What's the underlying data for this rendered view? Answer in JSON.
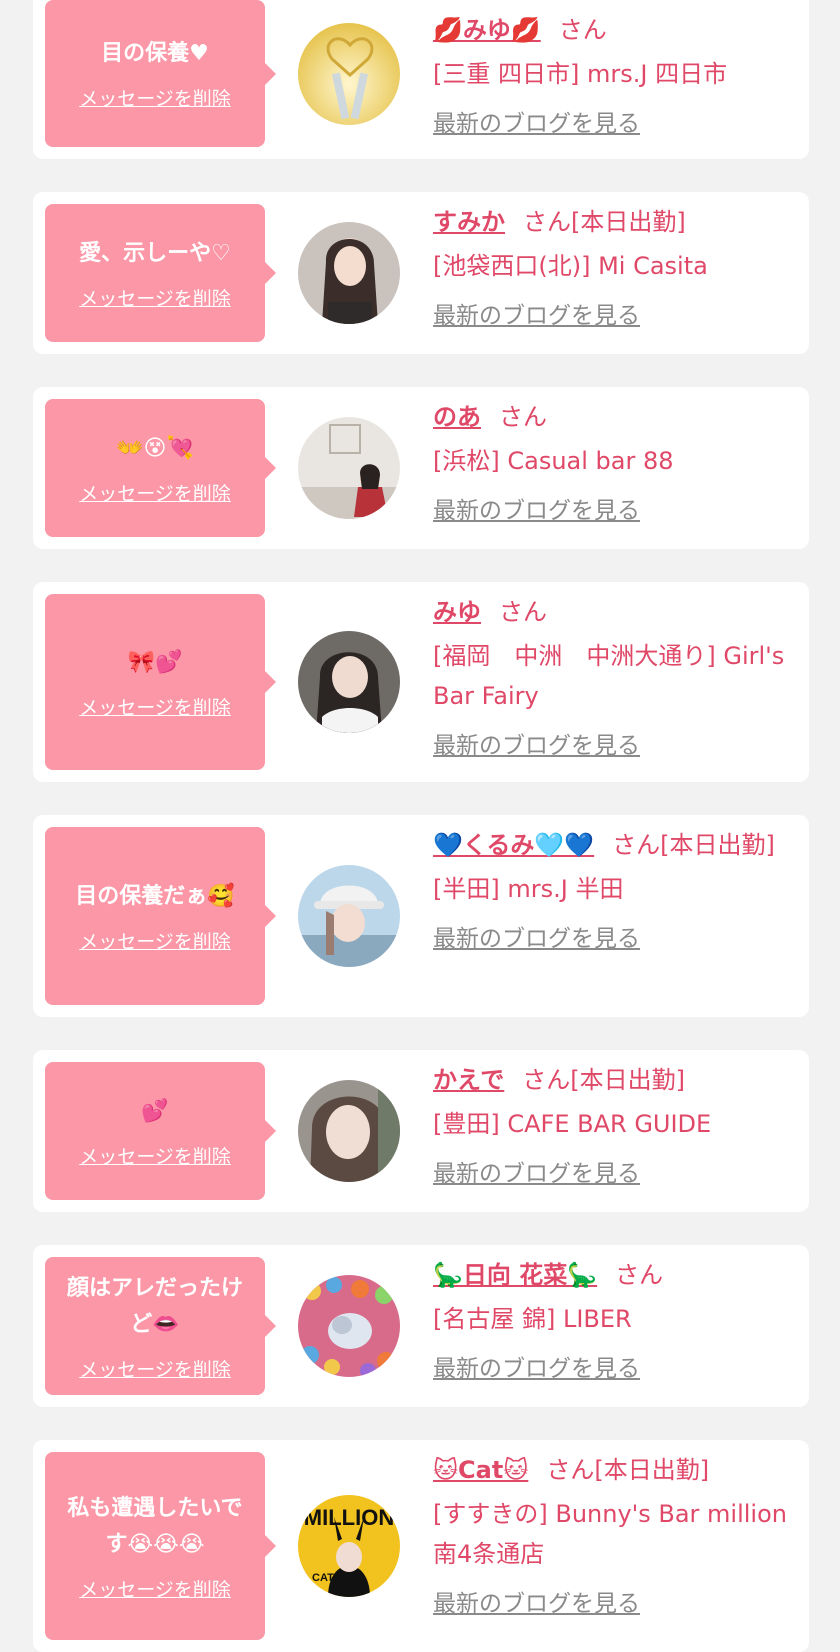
{
  "colors": {
    "accent": "#e04868",
    "bubble": "#fb97a6",
    "link_gray": "#8a8a8a",
    "background": "#f2f2f2"
  },
  "entries": [
    {
      "message": "目の保養♥",
      "delete_label": "メッセージを削除",
      "name": "💋みゆ💋",
      "suffix": "さん",
      "shop": "[三重 四日市] mrs.J 四日市",
      "blog_label": "最新のブログを見る"
    },
    {
      "message": "愛、示しーや♡",
      "delete_label": "メッセージを削除",
      "name": "すみか",
      "suffix": "さん[本日出勤]",
      "shop": "[池袋西口(北)] Mi Casita",
      "blog_label": "最新のブログを見る"
    },
    {
      "message": "👐😵💘",
      "delete_label": "メッセージを削除",
      "name": "のあ",
      "suffix": "さん",
      "shop": "[浜松] Casual bar 88",
      "blog_label": "最新のブログを見る"
    },
    {
      "message": "🎀💕",
      "delete_label": "メッセージを削除",
      "name": "みゆ",
      "suffix": "さん",
      "shop": "[福岡　中洲　中洲大通り] Girl's Bar Fairy",
      "blog_label": "最新のブログを見る"
    },
    {
      "message": "目の保養だぁ🥰",
      "delete_label": "メッセージを削除",
      "name": "💙くるみ🩵💙",
      "suffix": "さん[本日出勤]",
      "shop": "[半田] mrs.J 半田",
      "blog_label": "最新のブログを見る"
    },
    {
      "message": "💕",
      "delete_label": "メッセージを削除",
      "name": "かえで",
      "suffix": "さん[本日出勤]",
      "shop": "[豊田] CAFE BAR GUIDE",
      "blog_label": "最新のブログを見る"
    },
    {
      "message": "顔はアレだったけど👄",
      "delete_label": "メッセージを削除",
      "name": "🦕日向 花菜🦕",
      "suffix": "さん",
      "shop": "[名古屋 錦] LIBER",
      "blog_label": "最新のブログを見る"
    },
    {
      "message": "私も遭遇したいです😭😭😭",
      "delete_label": "メッセージを削除",
      "name": "🐱Cat🐱",
      "suffix": "さん[本日出勤]",
      "shop": "[すすきの] Bunny's Bar million 南4条通店",
      "blog_label": "最新のブログを見る"
    }
  ],
  "avatar_texts": {
    "entry_7": "MILLION",
    "entry_7_tag": "CAT"
  }
}
